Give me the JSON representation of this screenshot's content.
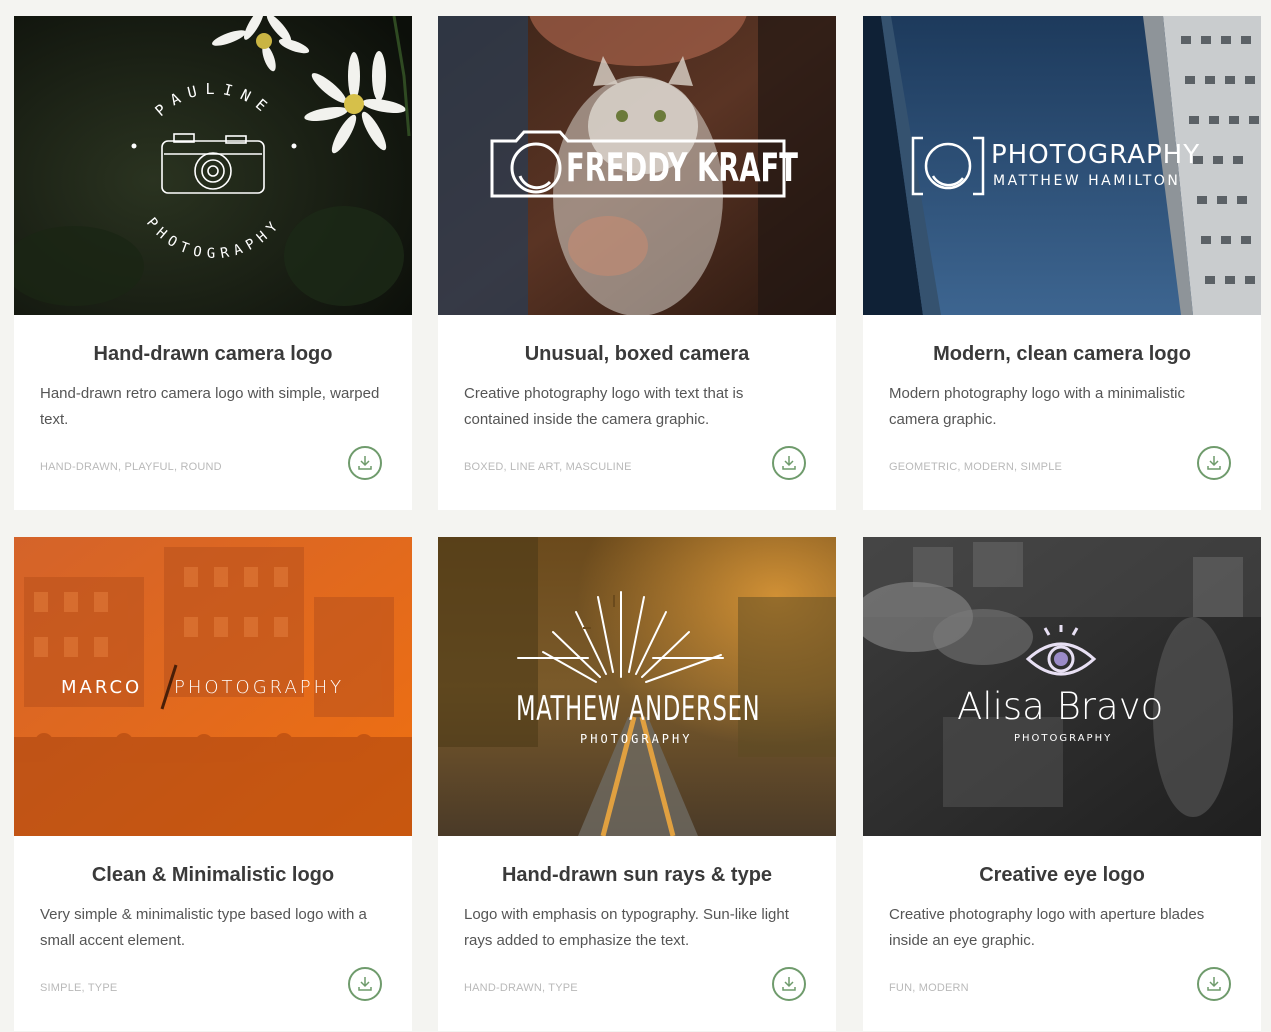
{
  "cards": [
    {
      "title": "Hand-drawn camera logo",
      "description": "Hand-drawn retro camera logo with simple, warped text.",
      "tags": "HAND-DRAWN, PLAYFUL, ROUND",
      "logo": {
        "top": "PAULINE",
        "bottom": "PHOTOGRAPHY"
      }
    },
    {
      "title": "Unusual, boxed camera",
      "description": "Creative photography logo with text that is contained inside the camera graphic.",
      "tags": "BOXED, LINE ART, MASCULINE",
      "logo": {
        "name": "FREDDY KRAFT"
      }
    },
    {
      "title": "Modern, clean camera logo",
      "description": "Modern photography logo with a minimalistic camera graphic.",
      "tags": "GEOMETRIC, MODERN, SIMPLE",
      "logo": {
        "name": "PHOTOGRAPHY",
        "sub": "MATTHEW HAMILTON"
      }
    },
    {
      "title": "Clean & Minimalistic logo",
      "description": "Very simple & minimalistic type based logo with a small accent element.",
      "tags": "SIMPLE, TYPE",
      "logo": {
        "left": "MARCO",
        "right": "PHOTOGRAPHY"
      }
    },
    {
      "title": "Hand-drawn sun rays & type",
      "description": "Logo with emphasis on typography. Sun-like light rays added to emphasize the text.",
      "tags": "HAND-DRAWN, TYPE",
      "logo": {
        "name": "MATHEW ANDERSEN",
        "sub": "PHOTOGRAPHY"
      }
    },
    {
      "title": "Creative eye logo",
      "description": "Creative photography logo with aperture blades inside an eye graphic.",
      "tags": "FUN, MODERN",
      "logo": {
        "name": "Alisa Bravo",
        "sub": "PHOTOGRAPHY"
      }
    }
  ],
  "colors": {
    "accent": "#6f9b6c",
    "tag": "#b9b9b9",
    "title": "#3a3a3a",
    "background": "#f4f4f1"
  },
  "icons": {
    "download": "download-icon"
  }
}
